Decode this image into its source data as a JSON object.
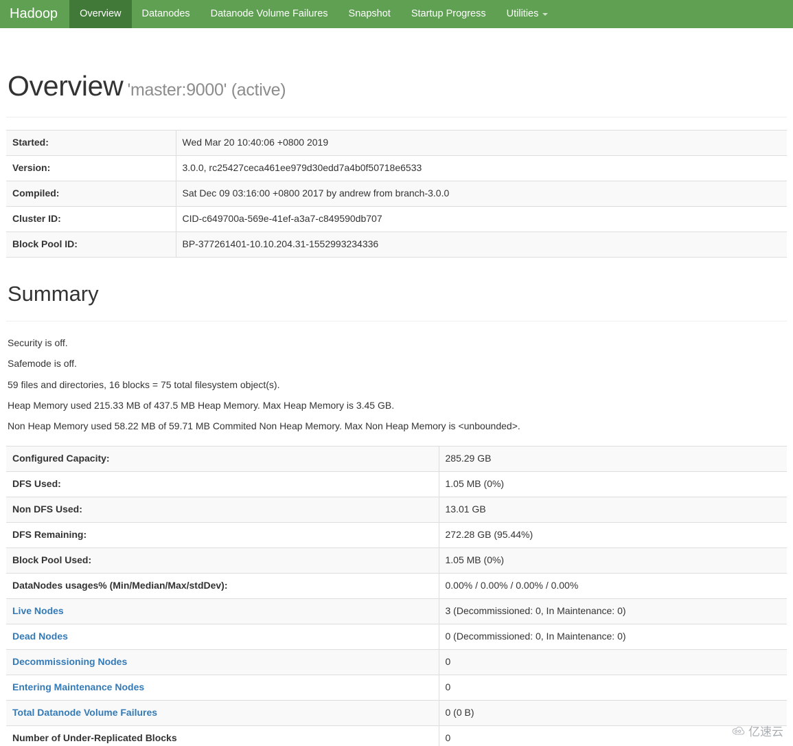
{
  "navbar": {
    "brand": "Hadoop",
    "brand_color": "#5fa052",
    "active_color": "#417a38",
    "items": [
      {
        "label": "Overview",
        "active": true
      },
      {
        "label": "Datanodes",
        "active": false
      },
      {
        "label": "Datanode Volume Failures",
        "active": false
      },
      {
        "label": "Snapshot",
        "active": false
      },
      {
        "label": "Startup Progress",
        "active": false
      },
      {
        "label": "Utilities",
        "active": false,
        "dropdown": true
      }
    ]
  },
  "overview": {
    "title": "Overview",
    "subtitle": "'master:9000' (active)",
    "rows": [
      {
        "label": "Started:",
        "value": "Wed Mar 20 10:40:06 +0800 2019"
      },
      {
        "label": "Version:",
        "value": "3.0.0, rc25427ceca461ee979d30edd7a4b0f50718e6533"
      },
      {
        "label": "Compiled:",
        "value": "Sat Dec 09 03:16:00 +0800 2017 by andrew from branch-3.0.0"
      },
      {
        "label": "Cluster ID:",
        "value": "CID-c649700a-569e-41ef-a3a7-c849590db707"
      },
      {
        "label": "Block Pool ID:",
        "value": "BP-377261401-10.10.204.31-1552993234336"
      }
    ]
  },
  "summary": {
    "title": "Summary",
    "lines": [
      "Security is off.",
      "Safemode is off.",
      "59 files and directories, 16 blocks = 75 total filesystem object(s).",
      "Heap Memory used 215.33 MB of 437.5 MB Heap Memory. Max Heap Memory is 3.45 GB.",
      "Non Heap Memory used 58.22 MB of 59.71 MB Commited Non Heap Memory. Max Non Heap Memory is <unbounded>."
    ],
    "link_color": "#337ab7",
    "rows": [
      {
        "label": "Configured Capacity:",
        "value": "285.29 GB",
        "link": false
      },
      {
        "label": "DFS Used:",
        "value": "1.05 MB (0%)",
        "link": false
      },
      {
        "label": "Non DFS Used:",
        "value": "13.01 GB",
        "link": false
      },
      {
        "label": "DFS Remaining:",
        "value": "272.28 GB (95.44%)",
        "link": false
      },
      {
        "label": "Block Pool Used:",
        "value": "1.05 MB (0%)",
        "link": false
      },
      {
        "label": "DataNodes usages% (Min/Median/Max/stdDev):",
        "value": "0.00% / 0.00% / 0.00% / 0.00%",
        "link": false
      },
      {
        "label": "Live Nodes",
        "value": "3 (Decommissioned: 0, In Maintenance: 0)",
        "link": true
      },
      {
        "label": "Dead Nodes",
        "value": "0 (Decommissioned: 0, In Maintenance: 0)",
        "link": true
      },
      {
        "label": "Decommissioning Nodes",
        "value": "0",
        "link": true
      },
      {
        "label": "Entering Maintenance Nodes",
        "value": "0",
        "link": true
      },
      {
        "label": "Total Datanode Volume Failures",
        "value": "0 (0 B)",
        "link": true
      },
      {
        "label": "Number of Under-Replicated Blocks",
        "value": "0",
        "link": false
      }
    ]
  },
  "watermark": {
    "icon": "cloud-icon",
    "text": "亿速云"
  }
}
